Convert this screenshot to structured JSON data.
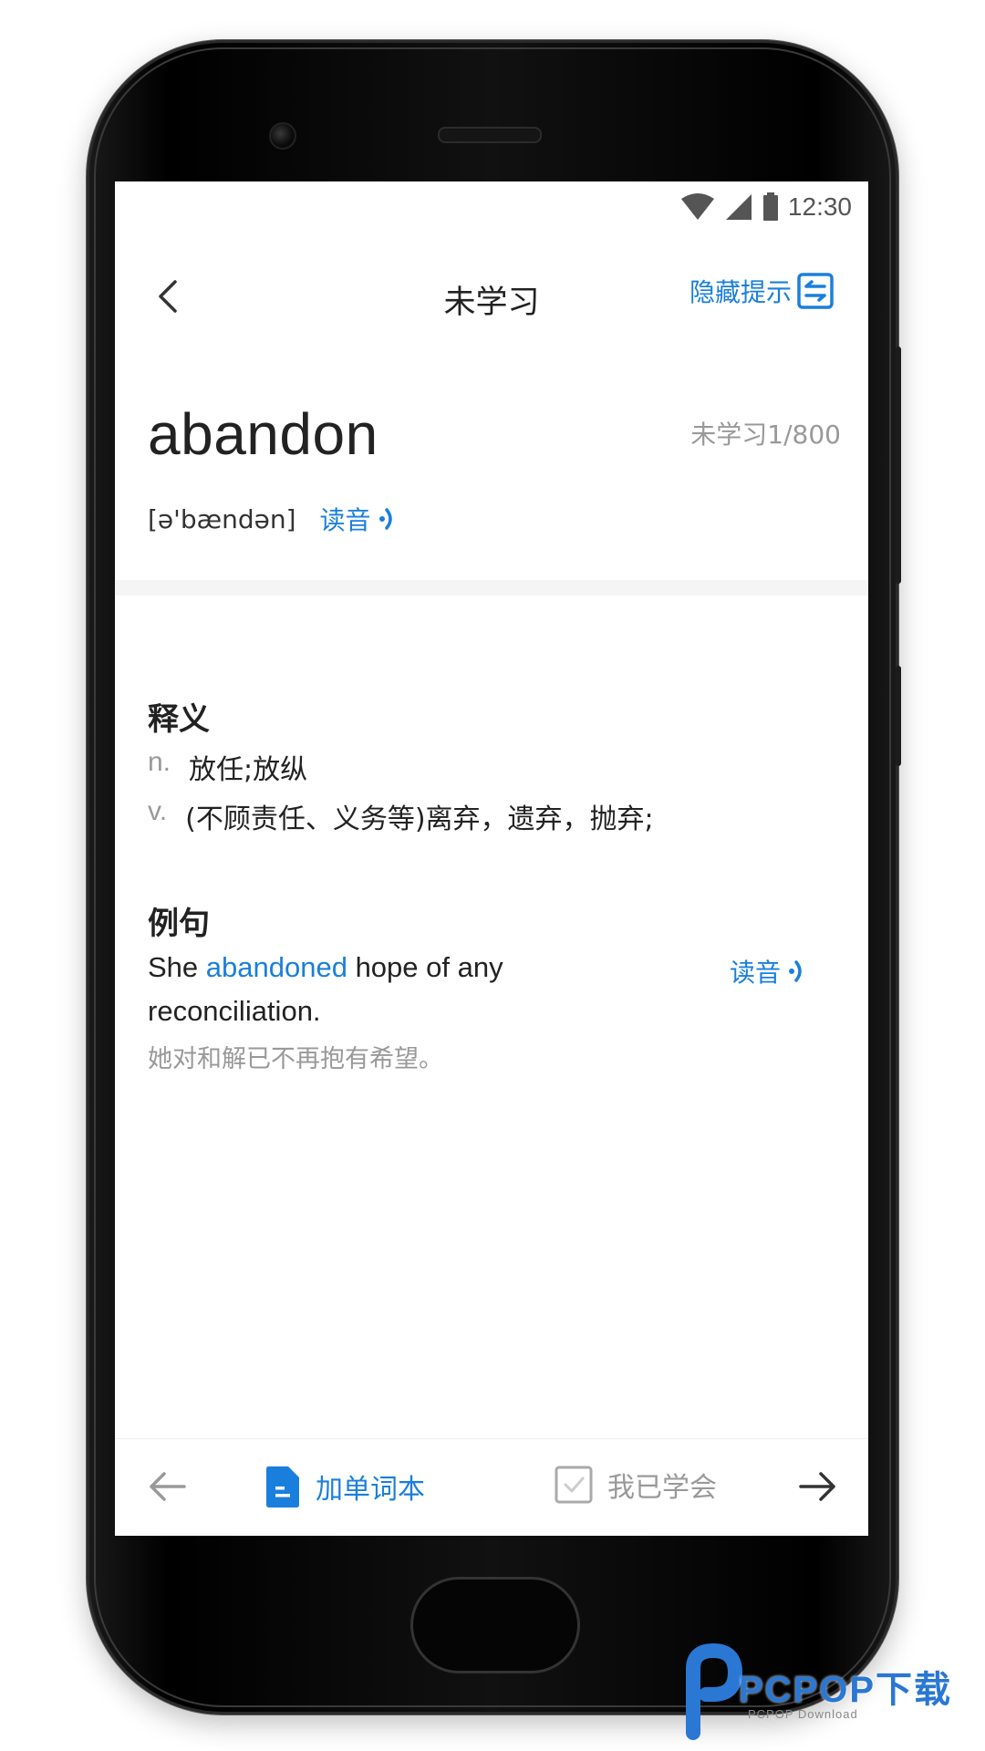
{
  "status_bar": {
    "time": "12:30",
    "icons": [
      "wifi-icon",
      "signal-icon",
      "battery-icon"
    ]
  },
  "header": {
    "title": "未学习",
    "hide_hint_label": "隐藏提示"
  },
  "word": {
    "text": "abandon",
    "progress": "未学习1/800",
    "phonetic": "[ə'bændən]",
    "read_label": "读音"
  },
  "definitions": {
    "title": "释义",
    "items": [
      {
        "pos": "n.",
        "meaning": "放任;放纵"
      },
      {
        "pos": "v.",
        "meaning": "(不顾责任、义务等)离弃，遗弃，抛弃;"
      }
    ]
  },
  "examples": {
    "title": "例句",
    "sentence_before": "She ",
    "sentence_highlight": "abandoned",
    "sentence_after": " hope of any reconciliation.",
    "translation": "她对和解已不再抱有希望。",
    "read_label": "读音"
  },
  "bottom_bar": {
    "add_label": "加单词本",
    "learned_label": "我已学会"
  },
  "watermark": {
    "brand": "PCPOP下载",
    "sub": "PCPOP Download"
  },
  "colors": {
    "accent": "#1a7fdc",
    "text": "#222222",
    "muted": "#999999"
  }
}
